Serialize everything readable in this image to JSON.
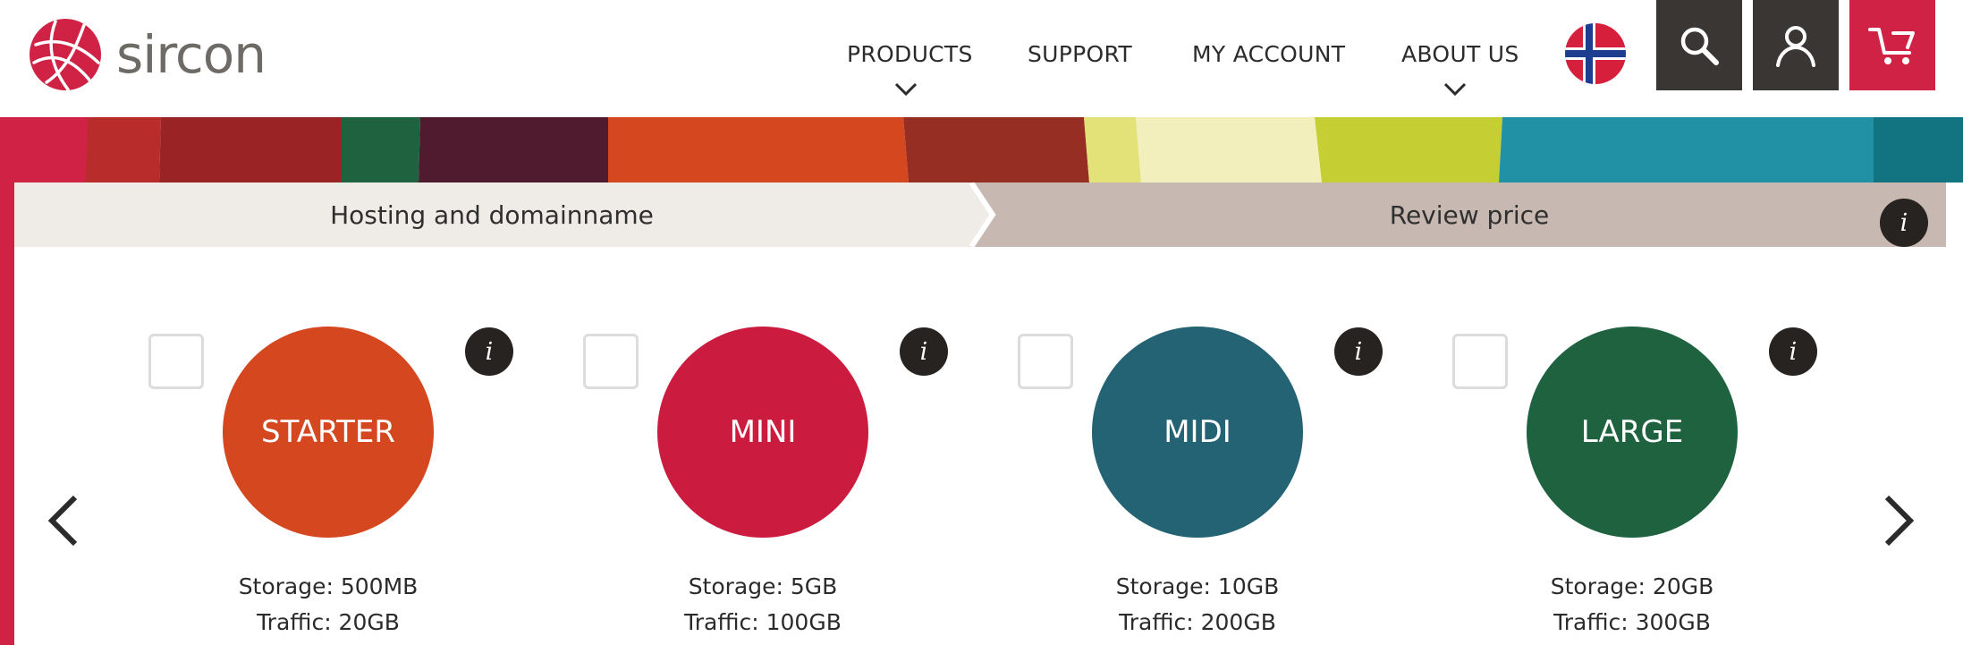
{
  "brand": {
    "name": "sircon",
    "accent": "#cf2244"
  },
  "nav": {
    "items": [
      {
        "label": "PRODUCTS",
        "has_dropdown": true
      },
      {
        "label": "SUPPORT",
        "has_dropdown": false
      },
      {
        "label": "MY ACCOUNT",
        "has_dropdown": false
      },
      {
        "label": "ABOUT US",
        "has_dropdown": true
      }
    ],
    "icons": [
      "norway-flag-icon",
      "search-icon",
      "user-icon",
      "cart-icon"
    ]
  },
  "steps": {
    "items": [
      {
        "label": "Hosting and domainname",
        "state": "active"
      },
      {
        "label": "Review price",
        "state": "inactive"
      }
    ],
    "info_glyph": "i"
  },
  "plans": [
    {
      "name": "STARTER",
      "color": "#d4471f",
      "storage": "Storage: 500MB",
      "traffic": "Traffic: 20GB",
      "info_glyph": "i"
    },
    {
      "name": "MINI",
      "color": "#cb1c3f",
      "storage": "Storage: 5GB",
      "traffic": "Traffic: 100GB",
      "info_glyph": "i"
    },
    {
      "name": "MIDI",
      "color": "#246374",
      "storage": "Storage: 10GB",
      "traffic": "Traffic: 200GB",
      "info_glyph": "i"
    },
    {
      "name": "LARGE",
      "color": "#1e6240",
      "storage": "Storage: 20GB",
      "traffic": "Traffic: 300GB",
      "info_glyph": "i"
    }
  ],
  "carousel": {
    "prev_icon": "chevron-left-icon",
    "next_icon": "chevron-right-icon"
  },
  "stripe_colors": [
    "#cf2244",
    "#b82c2c",
    "#9a2325",
    "#1e6240",
    "#511b2f",
    "#d4471f",
    "#962e24",
    "#e3e279",
    "#f2efbd",
    "#c5cf33",
    "#2191a5",
    "#127480"
  ]
}
